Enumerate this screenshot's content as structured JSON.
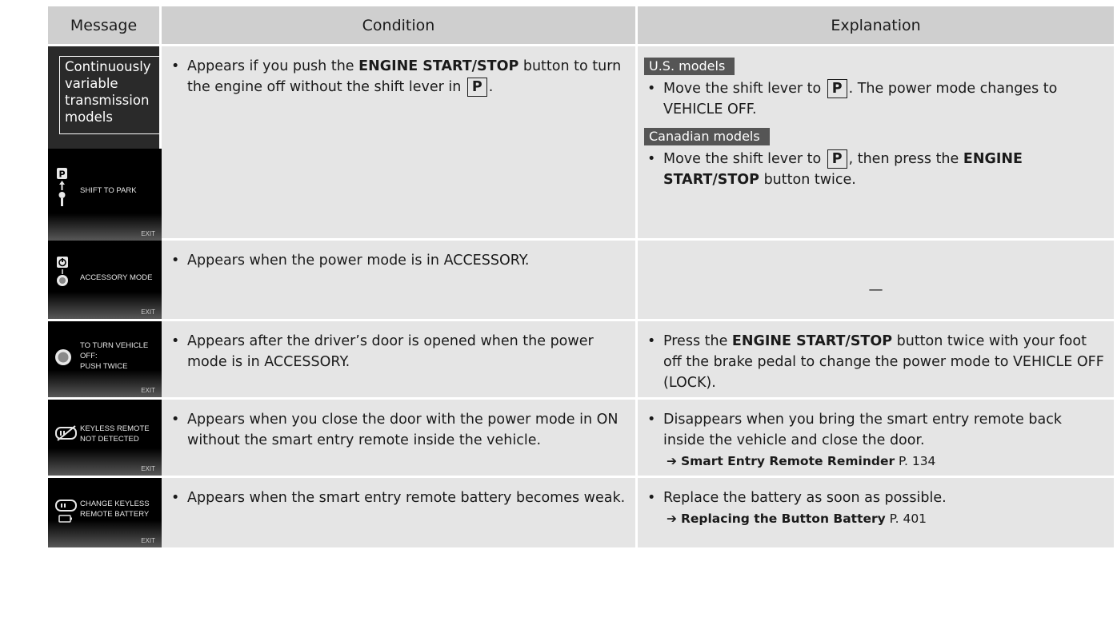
{
  "header": {
    "message": "Message",
    "condition": "Condition",
    "explanation": "Explanation"
  },
  "rows": [
    {
      "variant_label": "Continuously variable transmission models",
      "screen_text": [
        "SHIFT TO PARK"
      ],
      "screen_icon": "park-shift-icon",
      "condition": {
        "pre": "Appears if you push the ",
        "bold": "ENGINE START/STOP",
        "mid": " button to turn the engine off without the shift lever in ",
        "key": "P",
        "post": "."
      },
      "explanation": {
        "us_label": "U.S. models",
        "us_pre": "Move the shift lever to ",
        "us_key": "P",
        "us_post": ". The power mode changes to VEHICLE OFF.",
        "ca_label": "Canadian models",
        "ca_pre": "Move the shift lever to ",
        "ca_key": "P",
        "ca_mid": ", then press the ",
        "ca_bold": "ENGINE START/STOP",
        "ca_post": " button twice."
      }
    },
    {
      "screen_text": [
        "ACCESSORY MODE"
      ],
      "screen_icon": "power-icon",
      "condition": {
        "text": "Appears when the power mode is in ACCESSORY."
      },
      "explanation": {
        "dash": "—"
      }
    },
    {
      "screen_text": [
        "TO TURN VEHICLE",
        "OFF:",
        "PUSH TWICE"
      ],
      "screen_icon": "engine-button-icon",
      "condition": {
        "text": "Appears after the driver’s door is opened when the power mode is in ACCESSORY."
      },
      "explanation": {
        "pre": "Press the ",
        "bold": "ENGINE START/STOP",
        "post": " button twice with your foot off the brake pedal to change the power mode to VEHICLE OFF (LOCK)."
      }
    },
    {
      "screen_text": [
        "KEYLESS REMOTE",
        "NOT DETECTED"
      ],
      "screen_icon": "remote-not-detected-icon",
      "condition": {
        "text": "Appears when you close the door with the power mode in ON without the smart entry remote inside the vehicle."
      },
      "explanation": {
        "text": "Disappears when you bring the smart entry remote back inside the vehicle and close the door.",
        "xref_title": "Smart Entry Remote Reminder",
        "xref_page": "P. 134"
      }
    },
    {
      "screen_text": [
        "CHANGE KEYLESS",
        "REMOTE BATTERY"
      ],
      "screen_icon": "remote-battery-icon",
      "condition": {
        "text": "Appears when the smart entry remote battery becomes weak."
      },
      "explanation": {
        "text": "Replace the battery as soon as possible.",
        "xref_title": "Replacing the Button Battery",
        "xref_page": "P. 401"
      }
    }
  ],
  "screen_exit": "EXIT",
  "bullet": "•",
  "xref_arrow": "➔"
}
